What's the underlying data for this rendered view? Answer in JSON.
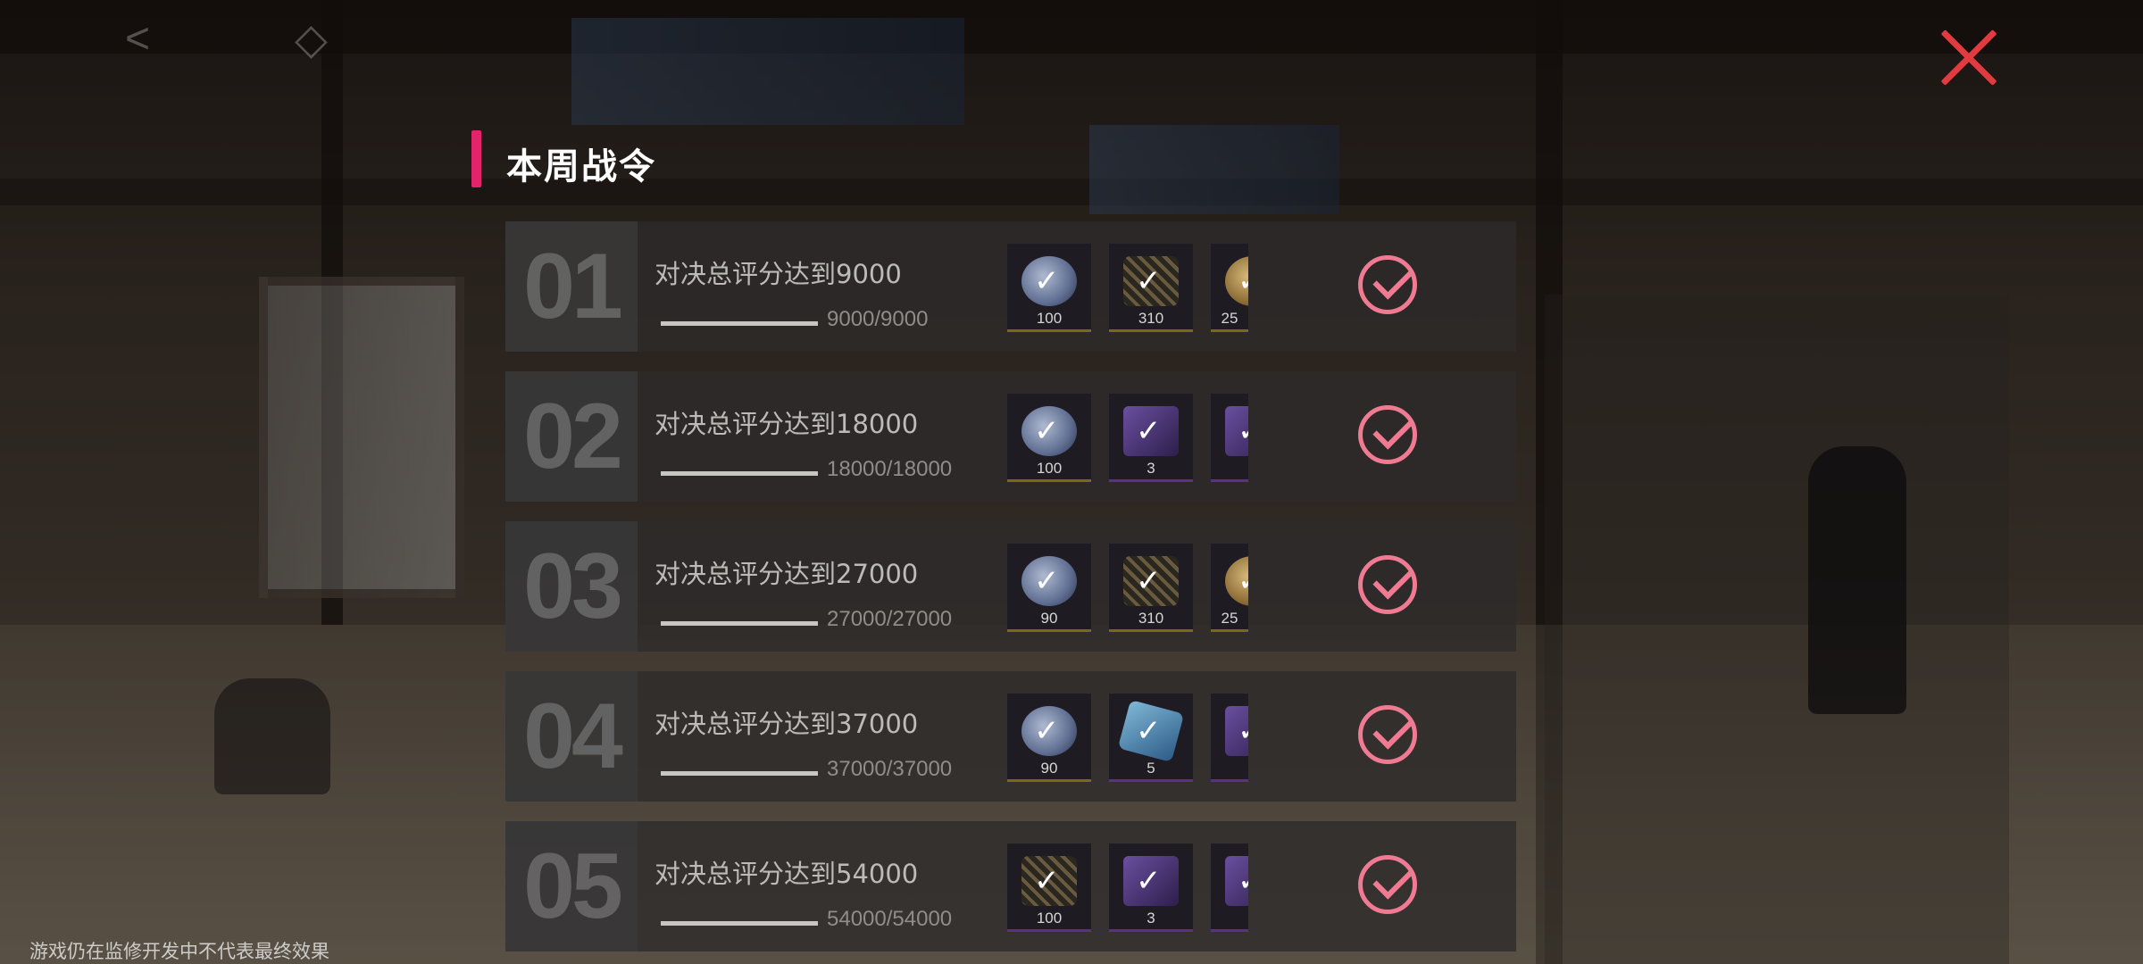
{
  "panel": {
    "title": "本周战令",
    "accent_color": "#e3236a",
    "close_icon": "close-icon",
    "complete_icon": "check-circle-icon",
    "complete_color": "#f07a92"
  },
  "tasks": [
    {
      "index": "01",
      "label": "对决总评分达到9000",
      "progress_text": "9000/9000",
      "progress_fraction": 1.0,
      "rewards": [
        {
          "icon": "silver-coin-icon",
          "qty": "100"
        },
        {
          "icon": "web-emblem-icon",
          "qty": "310"
        },
        {
          "icon": "gold-coin-icon",
          "qty": "25"
        }
      ],
      "status": "completed"
    },
    {
      "index": "02",
      "label": "对决总评分达到18000",
      "progress_text": "18000/18000",
      "progress_fraction": 1.0,
      "rewards": [
        {
          "icon": "silver-coin-icon",
          "qty": "100"
        },
        {
          "icon": "book-icon",
          "qty": "3"
        },
        {
          "icon": "purple-item-icon",
          "qty": ""
        }
      ],
      "status": "completed"
    },
    {
      "index": "03",
      "label": "对决总评分达到27000",
      "progress_text": "27000/27000",
      "progress_fraction": 1.0,
      "rewards": [
        {
          "icon": "silver-coin-icon",
          "qty": "90"
        },
        {
          "icon": "web-emblem-icon",
          "qty": "310"
        },
        {
          "icon": "gold-coin-icon",
          "qty": "25"
        }
      ],
      "status": "completed"
    },
    {
      "index": "04",
      "label": "对决总评分达到37000",
      "progress_text": "37000/37000",
      "progress_fraction": 1.0,
      "rewards": [
        {
          "icon": "silver-coin-icon",
          "qty": "90"
        },
        {
          "icon": "gem-icon",
          "qty": "5"
        },
        {
          "icon": "purple-item-icon",
          "qty": ""
        }
      ],
      "status": "completed"
    },
    {
      "index": "05",
      "label": "对决总评分达到54000",
      "progress_text": "54000/54000",
      "progress_fraction": 1.0,
      "rewards": [
        {
          "icon": "web-emblem-icon",
          "qty": "100"
        },
        {
          "icon": "book-icon",
          "qty": "3"
        },
        {
          "icon": "purple-item-icon",
          "qty": ""
        }
      ],
      "status": "completed"
    }
  ],
  "footer": {
    "disclaimer": "游戏仍在监修开发中不代表最终效果"
  }
}
